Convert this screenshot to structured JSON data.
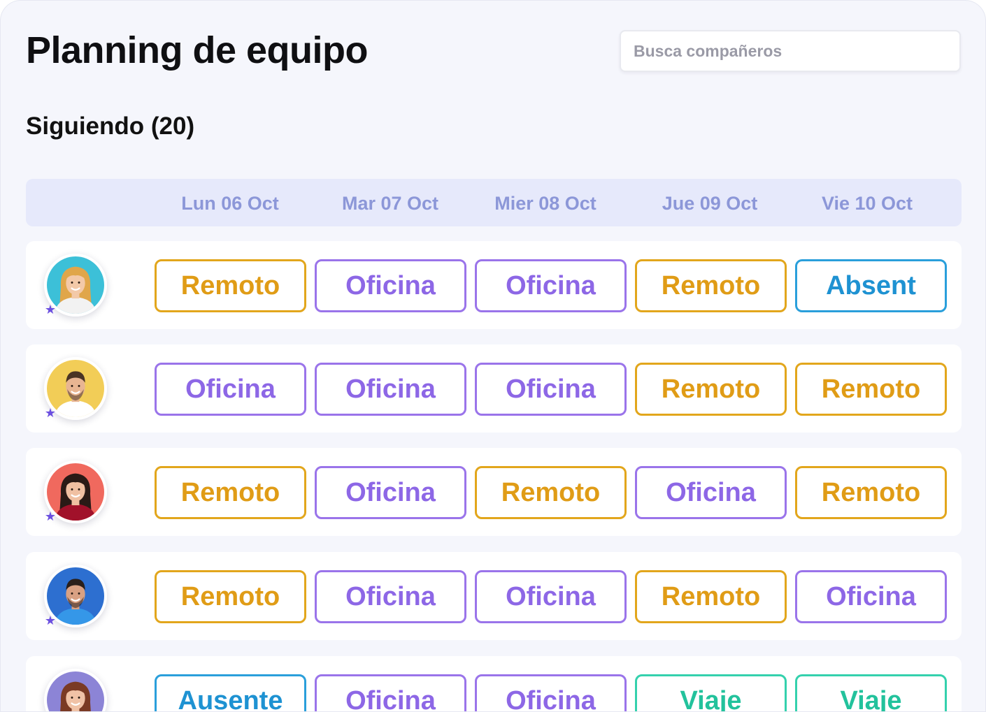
{
  "header": {
    "title": "Planning de equipo",
    "search_placeholder": "Busca compañeros"
  },
  "section": {
    "following_label": "Siguiendo (20)"
  },
  "dates": [
    "Lun 06 Oct",
    "Mar 07 Oct",
    "Mier 08 Oct",
    "Jue 09 Oct",
    "Vie 10 Oct"
  ],
  "status_colors": {
    "remoto": "#e09c16",
    "oficina": "#8d67e6",
    "absent": "#1e92d2",
    "viaje": "#22c29c"
  },
  "rows": [
    {
      "avatar": {
        "bg": "#3cc0d8",
        "hair": "#e0a64a",
        "skin": "#f3c9a8",
        "shirt": "#f2f2f2",
        "gender": "female"
      },
      "favorite_icon": "star-icon",
      "days": [
        {
          "label": "Remoto",
          "type": "remoto"
        },
        {
          "label": "Oficina",
          "type": "oficina"
        },
        {
          "label": "Oficina",
          "type": "oficina"
        },
        {
          "label": "Remoto",
          "type": "remoto"
        },
        {
          "label": "Absent",
          "type": "absent"
        }
      ]
    },
    {
      "avatar": {
        "bg": "#f2cd57",
        "hair": "#4a3424",
        "skin": "#e8b592",
        "shirt": "#ffffff",
        "gender": "male"
      },
      "favorite_icon": "star-icon",
      "days": [
        {
          "label": "Oficina",
          "type": "oficina"
        },
        {
          "label": "Oficina",
          "type": "oficina"
        },
        {
          "label": "Oficina",
          "type": "oficina"
        },
        {
          "label": "Remoto",
          "type": "remoto"
        },
        {
          "label": "Remoto",
          "type": "remoto"
        }
      ]
    },
    {
      "avatar": {
        "bg": "#f0695e",
        "hair": "#2a1a16",
        "skin": "#f0c0a2",
        "shirt": "#a1112a",
        "gender": "female"
      },
      "favorite_icon": "star-icon",
      "days": [
        {
          "label": "Remoto",
          "type": "remoto"
        },
        {
          "label": "Oficina",
          "type": "oficina"
        },
        {
          "label": "Remoto",
          "type": "remoto"
        },
        {
          "label": "Oficina",
          "type": "oficina"
        },
        {
          "label": "Remoto",
          "type": "remoto"
        }
      ]
    },
    {
      "avatar": {
        "bg": "#2d6fd0",
        "hair": "#2a1f1a",
        "skin": "#d9a183",
        "shirt": "#3597e8",
        "gender": "male"
      },
      "favorite_icon": "star-icon",
      "days": [
        {
          "label": "Remoto",
          "type": "remoto"
        },
        {
          "label": "Oficina",
          "type": "oficina"
        },
        {
          "label": "Oficina",
          "type": "oficina"
        },
        {
          "label": "Remoto",
          "type": "remoto"
        },
        {
          "label": "Oficina",
          "type": "oficina"
        }
      ]
    },
    {
      "avatar": {
        "bg": "#8c84d6",
        "hair": "#7a3a24",
        "skin": "#f0c2a6",
        "shirt": "#5a4aa8",
        "gender": "female"
      },
      "favorite_icon": "star-icon",
      "days": [
        {
          "label": "Ausente",
          "type": "absent"
        },
        {
          "label": "Oficina",
          "type": "oficina"
        },
        {
          "label": "Oficina",
          "type": "oficina"
        },
        {
          "label": "Viaje",
          "type": "viaje"
        },
        {
          "label": "Viaje",
          "type": "viaje"
        }
      ]
    }
  ]
}
